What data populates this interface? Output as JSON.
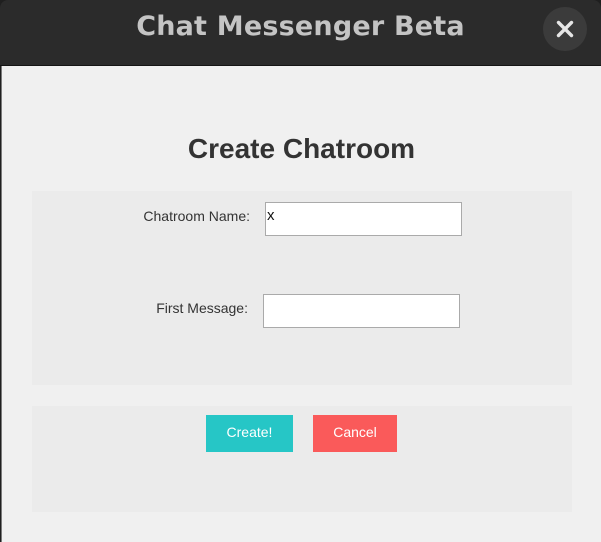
{
  "window": {
    "title": "Chat Messenger Beta",
    "close_icon": "close-icon"
  },
  "form": {
    "heading": "Create Chatroom",
    "chatroom_name_label": "Chatroom Name:",
    "chatroom_name_value": "x",
    "first_message_label": "First Message:",
    "first_message_value": ""
  },
  "buttons": {
    "create_label": "Create!",
    "cancel_label": "Cancel"
  },
  "colors": {
    "create_button": "#26c6c6",
    "cancel_button": "#fa5a5a",
    "titlebar": "#2b2b2b",
    "background": "#f0f0f0"
  }
}
